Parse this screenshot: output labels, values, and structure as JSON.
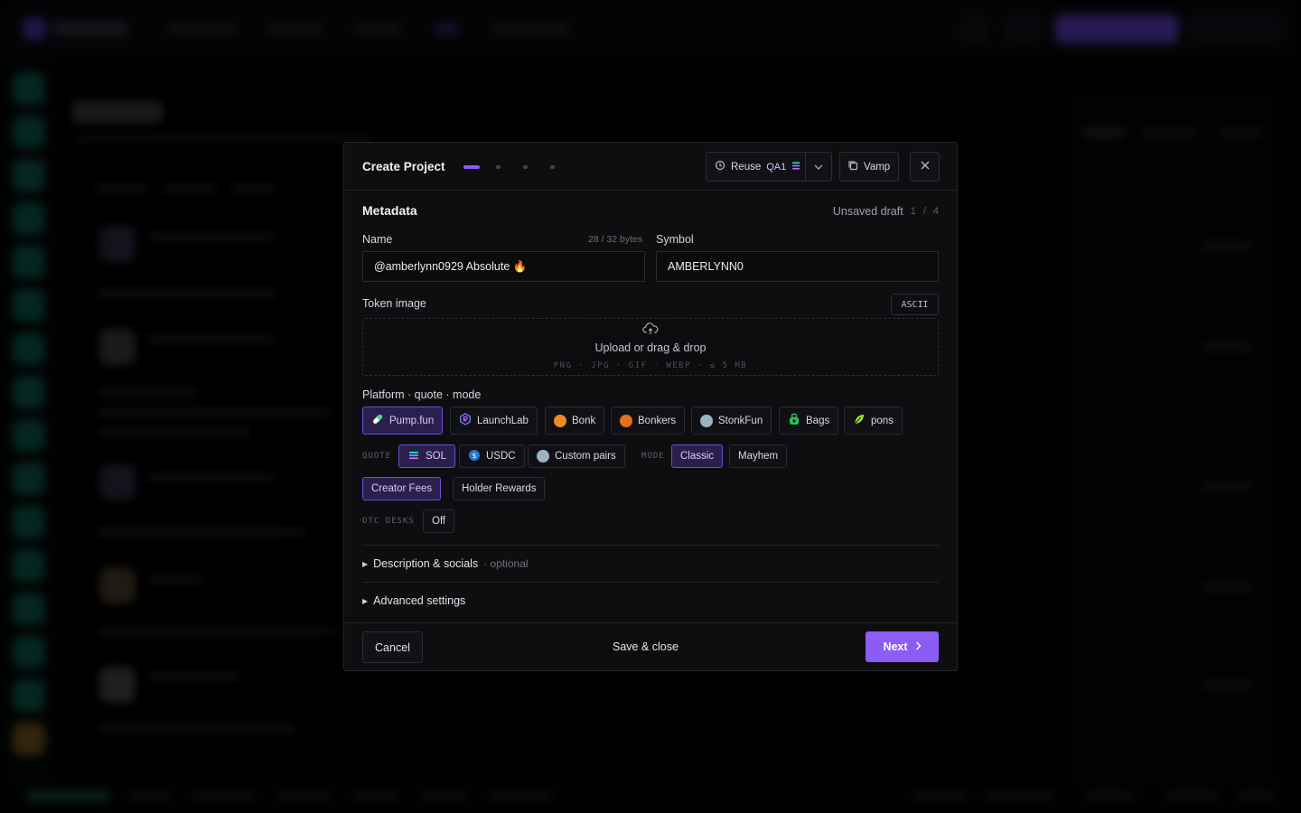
{
  "modal": {
    "title": "Create Project",
    "step_current": 1,
    "step_total": 4,
    "reuse": {
      "label": "Reuse",
      "tag": "QA1",
      "tag_icon": "sol-icon"
    },
    "vamp_label": "Vamp",
    "section_title": "Metadata",
    "draft_status": "Unsaved draft",
    "draft_page": "1",
    "draft_sep": "/",
    "draft_total": "4",
    "name": {
      "label": "Name",
      "value": "@amberlynn0929 Absolute 🔥",
      "bytes": "28 / 32 bytes"
    },
    "symbol": {
      "label": "Symbol",
      "value": "AMBERLYNN0"
    },
    "token_image": {
      "label": "Token image",
      "ascii_label": "ASCII",
      "upload_text": "Upload or drag & drop",
      "formats_hint": "PNG · JPG · GIF · WEBP · ≤ 5 MB"
    },
    "platform_label": "Platform · quote · mode",
    "platforms": [
      {
        "label": "Pump.fun",
        "icon": "pill-icon",
        "selected": true
      },
      {
        "label": "LaunchLab",
        "icon": "raydium-icon",
        "selected": false
      },
      {
        "label": "Bonk",
        "icon": "bonk-icon",
        "selected": false
      },
      {
        "label": "Bonkers",
        "icon": "bonkers-icon",
        "selected": false
      },
      {
        "label": "StonkFun",
        "icon": "stonk-icon",
        "selected": false
      },
      {
        "label": "Bags",
        "icon": "bag-icon",
        "selected": false
      },
      {
        "label": "pons",
        "icon": "leaf-icon",
        "selected": false
      }
    ],
    "quote_label": "QUOTE",
    "quotes": [
      {
        "label": "SOL",
        "icon": "sol-icon",
        "selected": true
      },
      {
        "label": "USDC",
        "icon": "usdc-icon",
        "selected": false
      },
      {
        "label": "Custom pairs",
        "icon": "custom-pair-icon",
        "selected": false
      }
    ],
    "mode_label": "MODE",
    "modes": [
      {
        "label": "Classic",
        "selected": true
      },
      {
        "label": "Mayhem",
        "selected": false
      }
    ],
    "fee_options": [
      {
        "label": "Creator Fees",
        "selected": true
      },
      {
        "label": "Holder Rewards",
        "selected": false
      }
    ],
    "otc_label": "OTC DESKS",
    "otc_value": "Off",
    "description_label": "Description & socials",
    "description_optional": "· optional",
    "advanced_label": "Advanced settings",
    "footer": {
      "cancel": "Cancel",
      "save_close": "Save & close",
      "next": "Next"
    }
  },
  "colors": {
    "accent": "#8b5cf6",
    "selected_bg": "#2a1f4d",
    "selected_border": "#6d4fd6",
    "modal_bg": "#0e0e11"
  }
}
